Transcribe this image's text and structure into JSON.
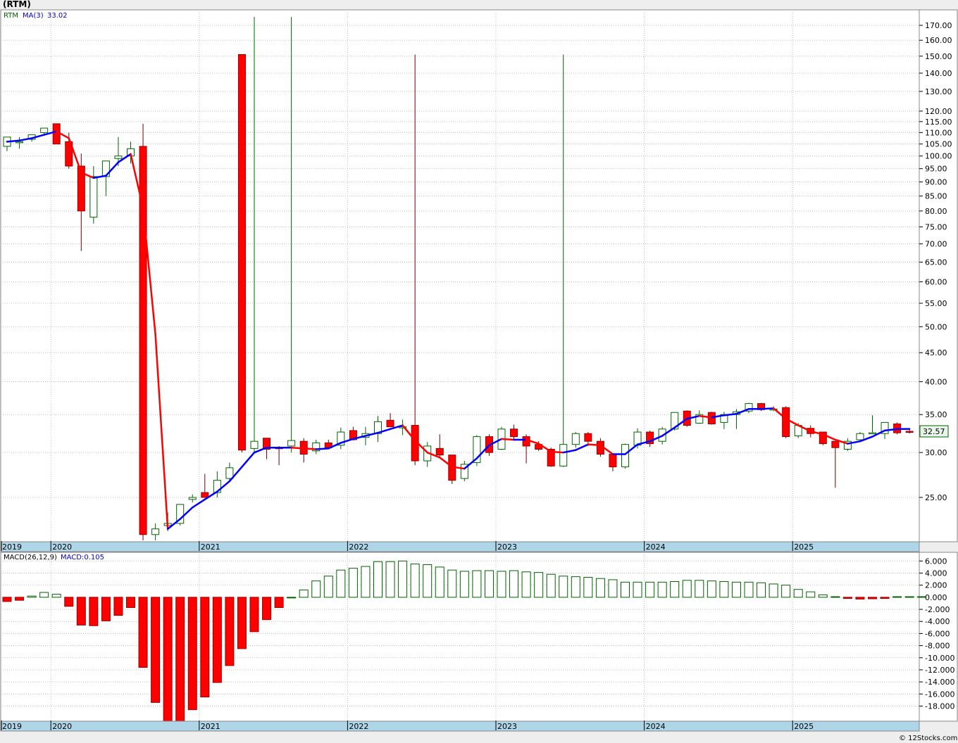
{
  "header": {
    "title": "(RTM)",
    "price_legend_symbol": "RTM",
    "price_legend_ma": "MA(3)",
    "price_legend_ma_value": "33.02",
    "macd_legend_label": "MACD(26,12,9)",
    "macd_legend_value": "MACD:0.105",
    "last_price_badge": "32.57",
    "watermark": "© 12Stocks.com"
  },
  "colors": {
    "up": "#006400",
    "down": "#ff0000",
    "ma_up": "#0000ff",
    "ma_down": "#ff0000",
    "grid": "#c0c0c0",
    "axis_band": "#aed6e8",
    "legend_blue": "#0000cc"
  },
  "chart_data": [
    {
      "type": "candlestick",
      "title": "(RTM)",
      "scale": "log",
      "ylim": [
        21,
        180
      ],
      "y_ticks": [
        25,
        30,
        35,
        40,
        45,
        50,
        55,
        60,
        65,
        70,
        75,
        80,
        85,
        90,
        95,
        100,
        105,
        110,
        115,
        120,
        130,
        140,
        150,
        160,
        170
      ],
      "x_labels": [
        "2019",
        "2020",
        "2021",
        "2022",
        "2023",
        "2024",
        "2025"
      ],
      "x_label_month_index": [
        0,
        4,
        16,
        28,
        40,
        52,
        64
      ],
      "candles": [
        {
          "o": 104,
          "h": 108,
          "l": 102,
          "c": 108
        },
        {
          "o": 106,
          "h": 108,
          "l": 103,
          "c": 106
        },
        {
          "o": 107,
          "h": 109,
          "l": 106,
          "c": 109
        },
        {
          "o": 110,
          "h": 112,
          "l": 109,
          "c": 112
        },
        {
          "o": 114,
          "h": 114,
          "l": 105,
          "c": 105
        },
        {
          "o": 106,
          "h": 110,
          "l": 95,
          "c": 96
        },
        {
          "o": 96,
          "h": 101,
          "l": 68,
          "c": 80
        },
        {
          "o": 78,
          "h": 96,
          "l": 76,
          "c": 92
        },
        {
          "o": 92,
          "h": 98,
          "l": 85,
          "c": 98
        },
        {
          "o": 99,
          "h": 108,
          "l": 96,
          "c": 100
        },
        {
          "o": 100,
          "h": 106,
          "l": 97,
          "c": 103
        },
        {
          "o": 104,
          "h": 114,
          "l": 21,
          "c": 21.5
        },
        {
          "o": 21.5,
          "h": 22.5,
          "l": 21,
          "c": 22
        },
        {
          "o": 22.3,
          "h": 23.5,
          "l": 21.8,
          "c": 22.5
        },
        {
          "o": 22.5,
          "h": 24.3,
          "l": 22.3,
          "c": 24.3
        },
        {
          "o": 24.8,
          "h": 25.3,
          "l": 24.5,
          "c": 25
        },
        {
          "o": 25.5,
          "h": 27.5,
          "l": 25,
          "c": 25
        },
        {
          "o": 25.5,
          "h": 27.8,
          "l": 25,
          "c": 26.8
        },
        {
          "o": 27,
          "h": 28.8,
          "l": 26.8,
          "c": 28.2
        },
        {
          "o": 151,
          "h": 151,
          "l": 30,
          "c": 30.3
        },
        {
          "o": 30.5,
          "h": 176,
          "l": 30,
          "c": 31.4
        },
        {
          "o": 31.8,
          "h": 31.8,
          "l": 29.2,
          "c": 30.4
        },
        {
          "o": 30.6,
          "h": 30.8,
          "l": 28.5,
          "c": 30.5
        },
        {
          "o": 30.8,
          "h": 176,
          "l": 30,
          "c": 31.5
        },
        {
          "o": 31.4,
          "h": 31.8,
          "l": 28.8,
          "c": 29.8
        },
        {
          "o": 30.2,
          "h": 31.6,
          "l": 29.8,
          "c": 31.2
        },
        {
          "o": 31.2,
          "h": 31.6,
          "l": 30.5,
          "c": 30.6
        },
        {
          "o": 30.9,
          "h": 33.2,
          "l": 30.4,
          "c": 32.6
        },
        {
          "o": 32.8,
          "h": 33.3,
          "l": 31.5,
          "c": 31.6
        },
        {
          "o": 31.9,
          "h": 33.3,
          "l": 30.9,
          "c": 32.4
        },
        {
          "o": 32.4,
          "h": 34.8,
          "l": 31.3,
          "c": 34
        },
        {
          "o": 34.2,
          "h": 35.2,
          "l": 33.3,
          "c": 33.3
        },
        {
          "o": 33.3,
          "h": 34.3,
          "l": 32.2,
          "c": 33.3
        },
        {
          "o": 33.5,
          "h": 151,
          "l": 28.5,
          "c": 29
        },
        {
          "o": 29,
          "h": 31.3,
          "l": 28.3,
          "c": 30.8
        },
        {
          "o": 30.5,
          "h": 32.3,
          "l": 29.5,
          "c": 29.7
        },
        {
          "o": 29.7,
          "h": 29.7,
          "l": 26.4,
          "c": 26.8
        },
        {
          "o": 27,
          "h": 29,
          "l": 26.7,
          "c": 28.6
        },
        {
          "o": 28.8,
          "h": 32.2,
          "l": 28.4,
          "c": 32
        },
        {
          "o": 32,
          "h": 32.3,
          "l": 29.6,
          "c": 30
        },
        {
          "o": 30.4,
          "h": 33.3,
          "l": 30.3,
          "c": 33
        },
        {
          "o": 33,
          "h": 33.6,
          "l": 31.6,
          "c": 32
        },
        {
          "o": 32,
          "h": 32.3,
          "l": 28.7,
          "c": 30.8
        },
        {
          "o": 31,
          "h": 31.4,
          "l": 30.2,
          "c": 30.4
        },
        {
          "o": 30.4,
          "h": 30.6,
          "l": 28.3,
          "c": 28.4
        },
        {
          "o": 28.4,
          "h": 151,
          "l": 28.3,
          "c": 31
        },
        {
          "o": 31,
          "h": 32.6,
          "l": 30.6,
          "c": 32.4
        },
        {
          "o": 32.4,
          "h": 32.6,
          "l": 30.8,
          "c": 31.4
        },
        {
          "o": 31.4,
          "h": 31.8,
          "l": 29.5,
          "c": 29.8
        },
        {
          "o": 29.8,
          "h": 29.9,
          "l": 27.8,
          "c": 28.3
        },
        {
          "o": 28.3,
          "h": 31.1,
          "l": 28.1,
          "c": 31
        },
        {
          "o": 30.9,
          "h": 33.1,
          "l": 30.5,
          "c": 32.6
        },
        {
          "o": 32.6,
          "h": 32.8,
          "l": 30.7,
          "c": 31.1
        },
        {
          "o": 31.4,
          "h": 33.3,
          "l": 31,
          "c": 33
        },
        {
          "o": 33,
          "h": 35.3,
          "l": 32.8,
          "c": 35.3
        },
        {
          "o": 35.5,
          "h": 35.6,
          "l": 33.3,
          "c": 33.5
        },
        {
          "o": 33.8,
          "h": 35.6,
          "l": 33.7,
          "c": 35
        },
        {
          "o": 35.3,
          "h": 35.4,
          "l": 33.6,
          "c": 33.7
        },
        {
          "o": 33.9,
          "h": 35.4,
          "l": 33,
          "c": 35
        },
        {
          "o": 35,
          "h": 35.8,
          "l": 33,
          "c": 35.4
        },
        {
          "o": 35.5,
          "h": 36.7,
          "l": 35.2,
          "c": 36.6
        },
        {
          "o": 36.6,
          "h": 36.7,
          "l": 35.5,
          "c": 35.7
        },
        {
          "o": 35.8,
          "h": 36.2,
          "l": 35.5,
          "c": 35.8
        },
        {
          "o": 36,
          "h": 36.2,
          "l": 31.8,
          "c": 32
        },
        {
          "o": 32.1,
          "h": 33.8,
          "l": 31.8,
          "c": 33.5
        },
        {
          "o": 33.1,
          "h": 33.5,
          "l": 31.9,
          "c": 32.4
        },
        {
          "o": 32.6,
          "h": 32.6,
          "l": 30.9,
          "c": 31.1
        },
        {
          "o": 31.4,
          "h": 31.4,
          "l": 26,
          "c": 30.6
        },
        {
          "o": 30.4,
          "h": 31.8,
          "l": 30.2,
          "c": 31.4
        },
        {
          "o": 31.6,
          "h": 32.6,
          "l": 31.6,
          "c": 32.4
        },
        {
          "o": 32.5,
          "h": 34.9,
          "l": 32.5,
          "c": 32.5
        },
        {
          "o": 32.4,
          "h": 33.9,
          "l": 31.7,
          "c": 33.9
        },
        {
          "o": 33.7,
          "h": 33.9,
          "l": 32.3,
          "c": 32.5
        },
        {
          "o": 32.7,
          "h": 33.1,
          "l": 32.4,
          "c": 32.57
        }
      ],
      "ma3": [
        106,
        106.5,
        107.5,
        109,
        110.5,
        107.5,
        93.5,
        91.5,
        92.3,
        97.5,
        100.8,
        81,
        48.5,
        22,
        22.9,
        24,
        24.8,
        25.6,
        26.7,
        28.3,
        30,
        30.6,
        30.6,
        30.6,
        30.5,
        30.4,
        30.5,
        31.2,
        31.7,
        32.1,
        32.5,
        33,
        33.5,
        31.5,
        30,
        29.4,
        28.3,
        28.1,
        29.3,
        30.9,
        31.7,
        31.6,
        31.6,
        31.1,
        30.1,
        30,
        30.3,
        31,
        30.9,
        29.8,
        29.8,
        31,
        31.4,
        32.1,
        33.2,
        34.4,
        34.8,
        34.6,
        34.9,
        35.1,
        35.8,
        35.8,
        35.9,
        34.4,
        33.5,
        32.7,
        32.3,
        31.6,
        31.1,
        31.4,
        32,
        32.8,
        33,
        33.02
      ]
    },
    {
      "type": "bar",
      "title": "MACD(26,12,9)",
      "ylim": [
        -20.5,
        7.2
      ],
      "y_ticks": [
        6,
        4,
        2,
        0,
        -2,
        -4,
        -6,
        -8,
        -10,
        -12,
        -14,
        -16,
        -18
      ],
      "y_tick_labels": [
        "6.000",
        "4.000",
        "2.000",
        "0.000",
        "-2.000",
        "-4.000",
        "-6.000",
        "-8.000",
        "-10.000",
        "-12.000",
        "-14.000",
        "-16.000",
        "-18.000"
      ],
      "x_labels": [
        "2019",
        "2020",
        "2021",
        "2022",
        "2023",
        "2024",
        "2025"
      ],
      "values": [
        -0.7,
        -0.5,
        0.2,
        0.8,
        0.5,
        -1.5,
        -4.6,
        -4.7,
        -3.9,
        -3,
        -1.7,
        -11.6,
        -17.4,
        -20.5,
        -20.5,
        -18.6,
        -16.5,
        -14.1,
        -11.3,
        -8.5,
        -5.7,
        -3.7,
        -1.7,
        0,
        1.2,
        2.7,
        3.5,
        4.5,
        4.8,
        5.1,
        5.9,
        5.9,
        6,
        5.5,
        5.4,
        5,
        4.5,
        4.3,
        4.4,
        4.4,
        4.3,
        4.4,
        4.2,
        4.1,
        3.8,
        3.5,
        3.4,
        3.3,
        3.1,
        2.9,
        2.5,
        2.5,
        2.5,
        2.5,
        2.6,
        2.8,
        2.8,
        2.7,
        2.6,
        2.5,
        2.5,
        2.4,
        2.2,
        2.0,
        1.3,
        0.9,
        0.4,
        0.1,
        -0.2,
        -0.3,
        -0.25,
        -0.2,
        0.1,
        0.1,
        0.105
      ]
    }
  ]
}
